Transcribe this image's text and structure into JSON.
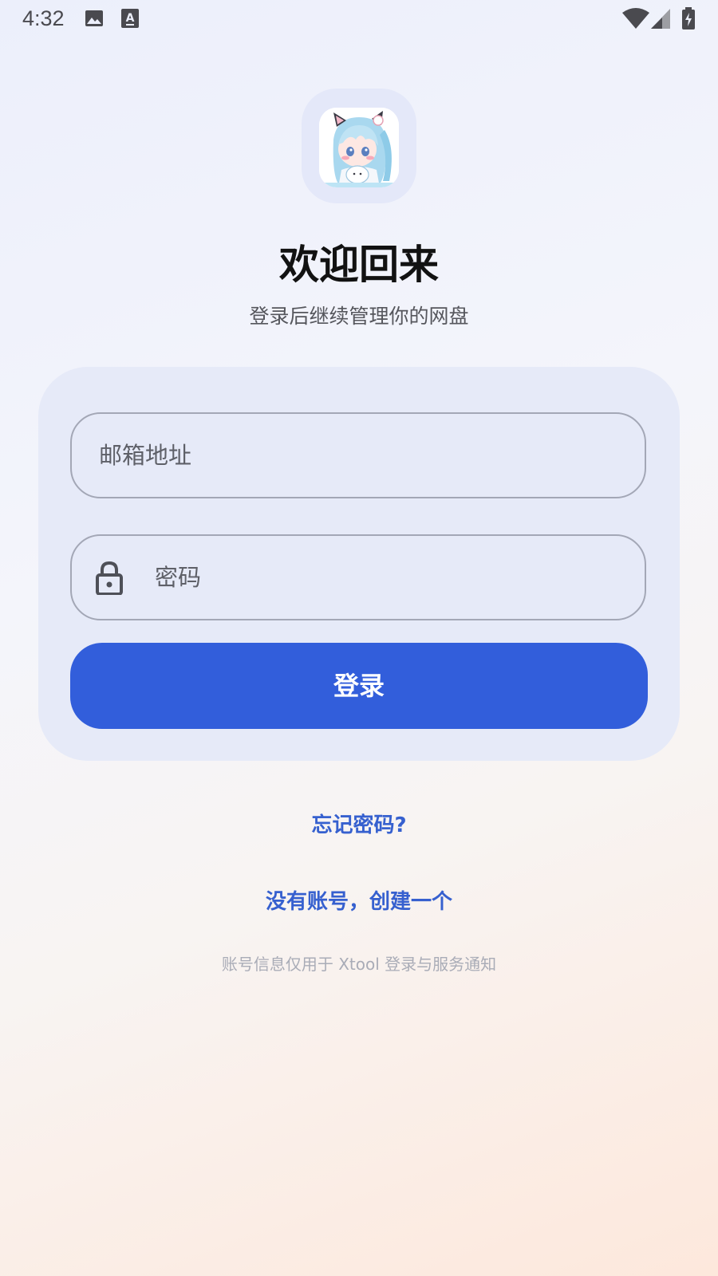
{
  "status_bar": {
    "time": "4:32",
    "left_icons": [
      "image-icon",
      "text-a-icon"
    ],
    "right_icons": [
      "wifi-icon",
      "cellular-signal-icon",
      "battery-charging-icon"
    ]
  },
  "app": {
    "logo": "anime-girl-avatar-logo",
    "title": "欢迎回来",
    "subtitle": "登录后继续管理你的网盘"
  },
  "form": {
    "email": {
      "placeholder": "邮箱地址",
      "value": ""
    },
    "password": {
      "placeholder": "密码",
      "value": "",
      "icon": "lock-icon"
    },
    "login_label": "登录"
  },
  "links": {
    "forgot_password": "忘记密码?",
    "register": "没有账号，创建一个"
  },
  "footnote": "账号信息仅用于 Xtool 登录与服务通知",
  "colors": {
    "primary": "#325edb",
    "link": "#3660cf",
    "card_bg": "#e6eaf8",
    "title": "#121212"
  }
}
